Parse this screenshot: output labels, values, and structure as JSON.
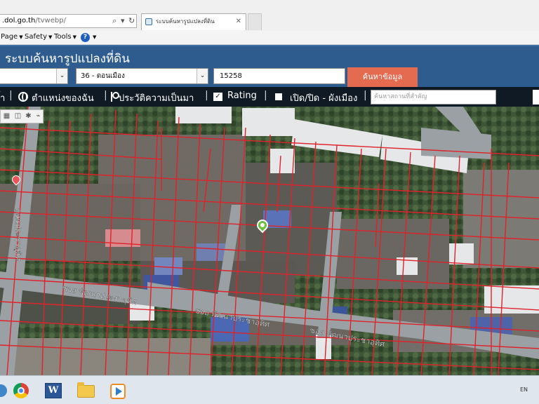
{
  "browser": {
    "address": {
      "host": ".dol.go.th",
      "path": "/tvwebp/"
    },
    "tab": {
      "title": "ระบบค้นหารูปแปลงที่ดิน"
    },
    "command_bar": {
      "page": "Page",
      "safety": "Safety",
      "tools": "Tools",
      "help_icon": "?"
    }
  },
  "site": {
    "title": "ระบบค้นหารูปแปลงที่ดิน"
  },
  "search": {
    "province_value": "",
    "district_value": "36 - ดอนเมือง",
    "parcel_number": "15258",
    "button_label": "ค้นหาข้อมูล"
  },
  "toolbar": {
    "first_partial": "้า",
    "location_label": "ตำแหน่งของฉัน",
    "history_label": "ประวัติความเป็นมา",
    "rating_label": "Rating",
    "layer_label": "เปิด/ปิด - ผังเมือง",
    "place_search_placeholder": "ค้นหาสถานที่สำคัญ",
    "separator": "|"
  },
  "map": {
    "road_labels": [
      "ซอย พัฒนาประชาอุทิศ",
      "ซอย พัฒนาประชาอุทิศ",
      "ซอย พัฒนาประชาอุทิศ",
      "ถนนประชาอุทิศ"
    ],
    "parcel_line_color": "#e0222a"
  },
  "taskbar": {
    "apps": [
      "chrome-icon",
      "word-icon",
      "folder-icon",
      "media-player-icon"
    ],
    "word_glyph": "W",
    "language": "EN"
  },
  "colors": {
    "header_blue": "#2f5c8f",
    "toolbar_dark": "#0f1a24",
    "search_button": "#e46a50"
  }
}
